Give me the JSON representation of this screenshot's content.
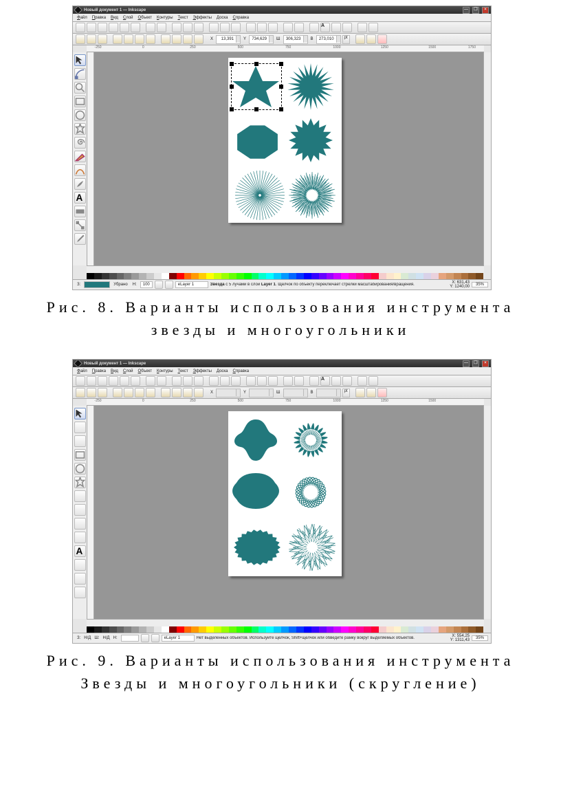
{
  "captions": {
    "fig8": "Рис. 8. Варианты использования инструмента звезды и многоугольники",
    "fig9": "Рис. 9. Варианты использования инструмента Звезды и многоугольники (скругление)"
  },
  "window_title": "Новый документ 1 — Inkscape",
  "menu": [
    "Файл",
    "Правка",
    "Вид",
    "Слой",
    "Объект",
    "Контуры",
    "Текст",
    "Эффекты",
    "Доска",
    "Справка"
  ],
  "menu_ul": [
    "Ф",
    "П",
    "В",
    "С",
    "О",
    "К",
    "Т",
    "Э",
    "Д",
    "С"
  ],
  "fig8": {
    "coords": {
      "x": "13,391",
      "y": "734,629",
      "w": "306,323",
      "h": "273,010"
    },
    "unit": "pt",
    "status_prefix": "Звезда",
    "status_mid": " с 5 лучами в слой ",
    "status_layer": "Layer 1",
    "status_rest": ". Щелчок по объекту переключает стрелки масштабирования/вращения.",
    "cursor": {
      "x": "X: 631,43",
      "y": "Y: 1240,00"
    },
    "zoom": "35%",
    "opacity_label": "Н:",
    "opacity": "100",
    "layer": "eLayer 1",
    "fill_label": "З:",
    "stroke_label": "Убрано"
  },
  "fig9": {
    "coords": {
      "x": "",
      "y": "",
      "w": "",
      "h": ""
    },
    "unit": "pt",
    "status": "Нет выделенных объектов. Используйте щелчок, Shift+щелчок или обведите рамку вокруг выделяемых объектов.",
    "cursor": {
      "x": "X: 554,25",
      "y": "Y: 1311,43"
    },
    "zoom": "35%",
    "opacity_label": "Н:",
    "layer": "eLayer 1",
    "fill_label": "З:",
    "fill_text": "Н/Д",
    "stroke_label": "Ш:",
    "stroke_text": "Н/Д"
  },
  "ruler_nums": [
    "-250",
    "0",
    "250",
    "500",
    "750",
    "1000",
    "1250",
    "1500",
    "1750"
  ],
  "palette_colors": [
    "#000000",
    "#1a1a1a",
    "#333333",
    "#4d4d4d",
    "#666666",
    "#808080",
    "#999999",
    "#b3b3b3",
    "#cccccc",
    "#e6e6e6",
    "#ffffff",
    "#800000",
    "#ff0000",
    "#ff6600",
    "#ff9900",
    "#ffcc00",
    "#ffff00",
    "#ccff00",
    "#99ff00",
    "#66ff00",
    "#33ff00",
    "#00ff00",
    "#00ff66",
    "#00ffcc",
    "#00ffff",
    "#00ccff",
    "#0099ff",
    "#0066ff",
    "#0033ff",
    "#0000ff",
    "#3300ff",
    "#6600ff",
    "#9900ff",
    "#cc00ff",
    "#ff00ff",
    "#ff00cc",
    "#ff0099",
    "#ff0066",
    "#ff0033",
    "#f4cccc",
    "#fce5cd",
    "#fff2cc",
    "#d9ead3",
    "#d0e0e3",
    "#cfe2f3",
    "#d9d2e9",
    "#ead1dc",
    "#e6a57e",
    "#d49a6a",
    "#c28552",
    "#ab6f3b",
    "#8f5a29",
    "#73451a"
  ],
  "teal": "#22787c"
}
